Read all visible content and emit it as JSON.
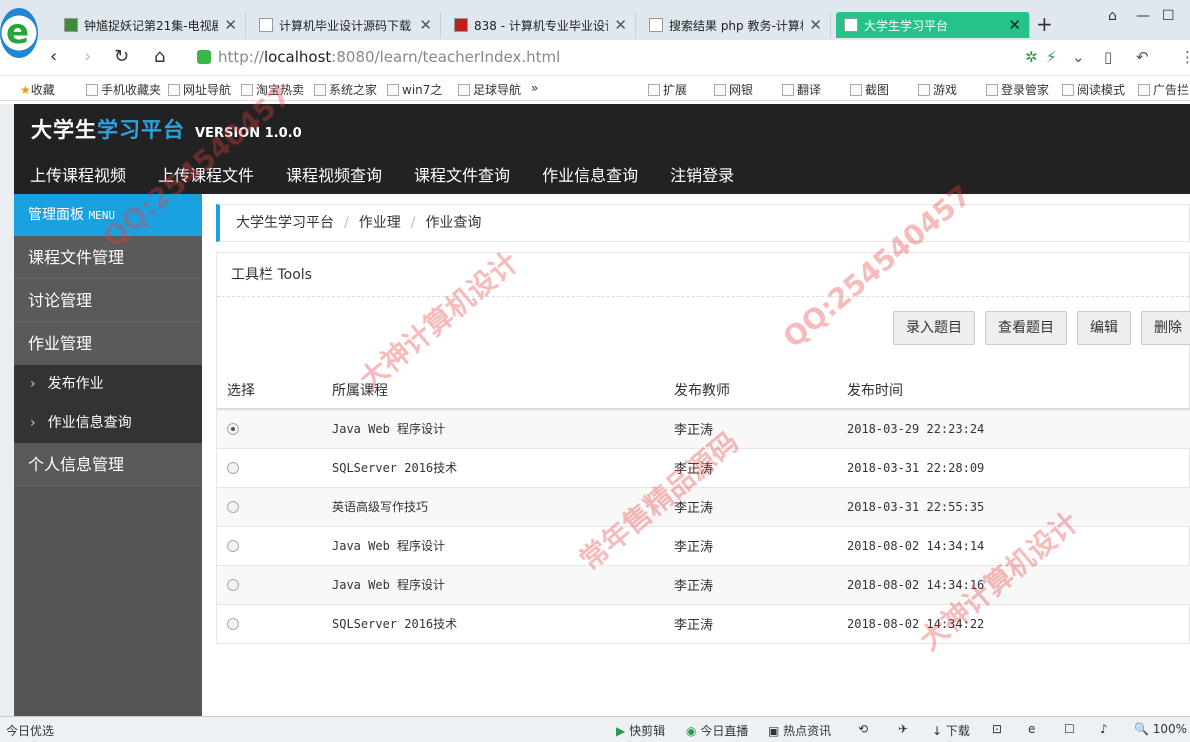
{
  "browser": {
    "logo": "e",
    "tabs": [
      {
        "title": "钟馗捉妖记第21集-电视剧",
        "active": false
      },
      {
        "title": "计算机毕业设计源码下载",
        "active": false
      },
      {
        "title": "838 - 计算机专业毕业设计",
        "active": false
      },
      {
        "title": "搜索结果 php 教务-计算机",
        "active": false
      },
      {
        "title": "大学生学习平台",
        "active": true
      }
    ],
    "url_scheme": "http://",
    "url_host": "localhost",
    "url_rest": ":8080/learn/teacherIndex.html",
    "favorites": [
      "收藏",
      "手机收藏夹",
      "网址导航",
      "淘宝热卖",
      "系统之家",
      "win7之",
      "足球导航",
      "»"
    ],
    "right_tools": [
      "扩展",
      "网银",
      "翻译",
      "截图",
      "游戏",
      "登录管家",
      "阅读模式",
      "广告拦"
    ]
  },
  "app": {
    "brand_main": "大学生",
    "brand_hl": "学习平台",
    "version": "VERSION 1.0.0",
    "topnav": [
      "上传课程视频",
      "上传课程文件",
      "课程视频查询",
      "课程文件查询",
      "作业信息查询",
      "注销登录"
    ],
    "sidebar": {
      "head": "管理面板",
      "head_sub": "MENU",
      "items": [
        "课程文件管理",
        "讨论管理",
        "作业管理"
      ],
      "subitems": [
        "发布作业",
        "作业信息查询"
      ],
      "last_item": "个人信息管理"
    },
    "breadcrumb": [
      "大学生学习平台",
      "作业理",
      "作业查询"
    ],
    "panel_title": "工具栏 Tools",
    "buttons": [
      "录入题目",
      "查看题目",
      "编辑",
      "删除"
    ],
    "table": {
      "headers": [
        "选择",
        "所属课程",
        "发布教师",
        "发布时间"
      ],
      "rows": [
        {
          "selected": true,
          "course": "Java Web 程序设计",
          "teacher": "李正涛",
          "time": "2018-03-29 22:23:24"
        },
        {
          "selected": false,
          "course": "SQLServer 2016技术",
          "teacher": "李正涛",
          "time": "2018-03-31 22:28:09"
        },
        {
          "selected": false,
          "course": "英语高级写作技巧",
          "teacher": "李正涛",
          "time": "2018-03-31 22:55:35"
        },
        {
          "selected": false,
          "course": "Java Web 程序设计",
          "teacher": "李正涛",
          "time": "2018-08-02 14:34:14"
        },
        {
          "selected": false,
          "course": "Java Web 程序设计",
          "teacher": "李正涛",
          "time": "2018-08-02 14:34:16"
        },
        {
          "selected": false,
          "course": "SQLServer 2016技术",
          "teacher": "李正涛",
          "time": "2018-08-02 14:34:22"
        }
      ]
    }
  },
  "statusbar": {
    "left": "今日优选",
    "items": [
      "快剪辑",
      "今日直播",
      "热点资讯",
      "下载",
      "100%"
    ]
  },
  "watermarks": [
    "QQ:254540457",
    "大神计算机设计",
    "常年售精品源码"
  ],
  "colors": {
    "accent": "#1aa1e0",
    "header": "#222222",
    "sidebar": "#555555",
    "active_tab": "#25c28a"
  }
}
